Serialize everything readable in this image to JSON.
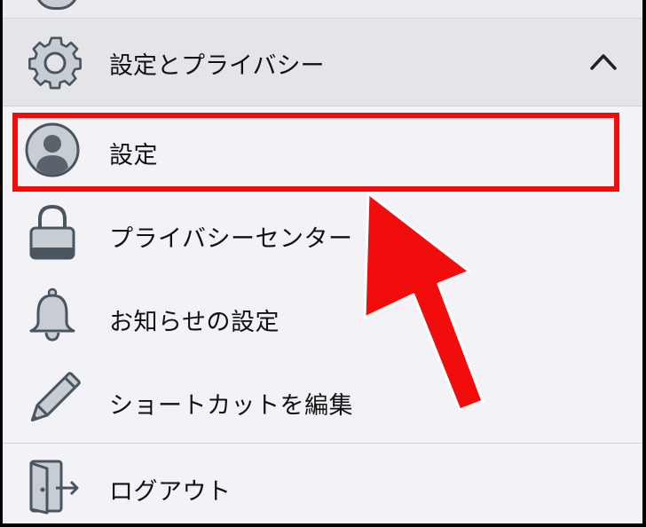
{
  "menu": {
    "section_title": "設定とプライバシー",
    "items": [
      {
        "label": "設定",
        "icon": "person-avatar-icon"
      },
      {
        "label": "プライバシーセンター",
        "icon": "lock-icon"
      },
      {
        "label": "お知らせの設定",
        "icon": "bell-icon"
      },
      {
        "label": "ショートカットを編集",
        "icon": "pencil-icon"
      }
    ],
    "logout_label": "ログアウト"
  },
  "annotation": {
    "highlight_color": "#f20d0d",
    "arrow_color": "#f20d0d"
  },
  "colors": {
    "background": "#f2f2f7",
    "section_header_bg": "#e4e5e9",
    "icon_gray": "#c7cdd3",
    "icon_stroke": "#4a5560"
  }
}
